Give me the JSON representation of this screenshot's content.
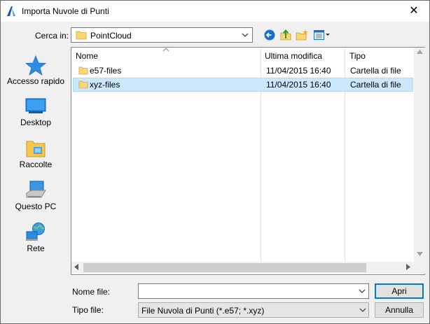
{
  "window": {
    "title": "Importa Nuvole di Punti",
    "close_symbol": "✕"
  },
  "lookin": {
    "label": "Cerca in:",
    "value": "PointCloud"
  },
  "toolbar": {
    "back_icon": "back-arrow-icon",
    "up_icon": "up-folder-icon",
    "newfolder_icon": "new-folder-icon",
    "view_icon": "view-menu-icon"
  },
  "places": [
    {
      "label": "Accesso rapido",
      "icon": "quick-access-star-icon"
    },
    {
      "label": "Desktop",
      "icon": "desktop-icon"
    },
    {
      "label": "Raccolte",
      "icon": "libraries-icon"
    },
    {
      "label": "Questo PC",
      "icon": "computer-icon"
    },
    {
      "label": "Rete",
      "icon": "network-icon"
    }
  ],
  "columns": {
    "name": "Nome",
    "modified": "Ultima modifica",
    "type": "Tipo"
  },
  "files": [
    {
      "name": "e57-files",
      "modified": "11/04/2015 16:40",
      "type": "Cartella di file",
      "selected": false
    },
    {
      "name": "xyz-files",
      "modified": "11/04/2015 16:40",
      "type": "Cartella di file",
      "selected": true
    }
  ],
  "filename": {
    "label": "Nome file:",
    "value": ""
  },
  "filetype": {
    "label": "Tipo file:",
    "value": "File Nuvola di Punti (*.e57; *.xyz)"
  },
  "buttons": {
    "open": "Apri",
    "cancel": "Annulla"
  },
  "colors": {
    "selection": "#cce8ff",
    "primary_border": "#0078d7",
    "folder": "#f8d775"
  }
}
